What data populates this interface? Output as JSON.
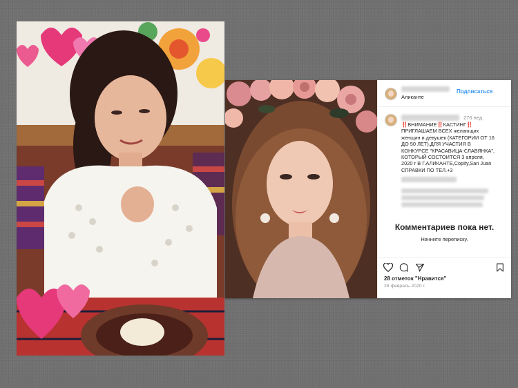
{
  "left_photo": {
    "description_icon": "portrait-photo"
  },
  "post": {
    "header": {
      "location": "Аликанте",
      "follow_label": "Подписаться"
    },
    "caption": {
      "time_ago": "276 нед.",
      "text": "‼️ВНИМАНИЕ‼️КАСТИНГ‼️\nПРИГЛАШАЕМ  ВСЕХ желающих\nженщин и девушек (КАТЕГОРИИ ОТ 16\nДО 50 ЛЕТ),ДЛЯ УЧАСТИЯ В\nКОНКУРСЕ \"КРАСАВИЦА-СЛАВЯНКА\",\nКОТОРЫЙ СОСТОИТСЯ 3 апреля,\n2020 г В Г.АЛИКАНТЕ,Copity,San Juan\nСПРАВКИ ПО ТЕЛ.+3"
    },
    "comments": {
      "empty_title": "Комментариев пока нет.",
      "empty_hint": "Начните переписку."
    },
    "actions": {
      "icons": [
        "heart-icon",
        "comment-icon",
        "share-icon",
        "bookmark-icon"
      ],
      "likes": "28 отметок \"Нравится\"",
      "date": "28 февраль 2020 г."
    },
    "colors": {
      "link": "#3897f0",
      "text": "#262626",
      "muted": "#8e8e8e",
      "warning": "#e0245e"
    }
  }
}
